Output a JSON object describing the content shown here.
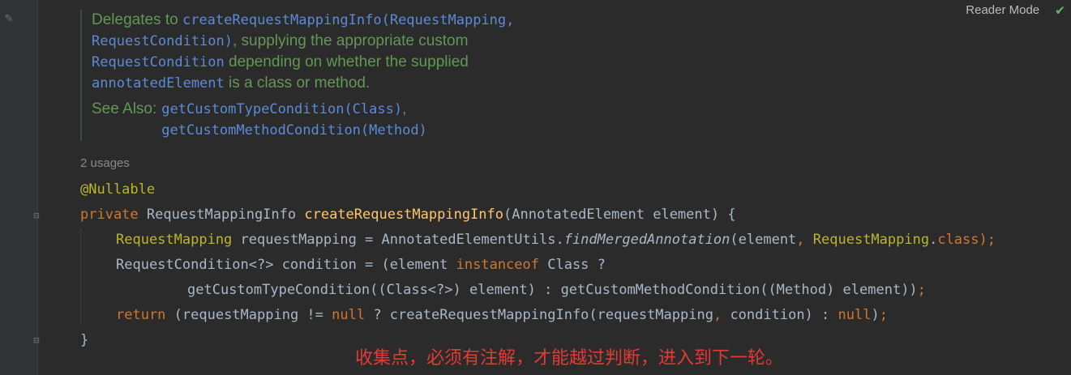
{
  "toolbar": {
    "reader_mode": "Reader Mode"
  },
  "javadoc": {
    "line1_prefix": "Delegates to ",
    "line1_code": "createRequestMappingInfo(RequestMapping,",
    "line2_code": "RequestCondition)",
    "line2_text": ", supplying the appropriate custom",
    "line3_code": "RequestCondition",
    "line3_text": " depending on whether the supplied",
    "line4_code": "annotatedElement",
    "line4_text": " is a class or method.",
    "see_also_label": "See Also:",
    "see_also_1": "getCustomTypeCondition(Class)",
    "see_also_1_sep": ",",
    "see_also_2": "getCustomMethodCondition(Method)"
  },
  "usages": "2 usages",
  "code": {
    "annotation": "@Nullable",
    "l2_kw": "private",
    "l2_type": " RequestMappingInfo ",
    "l2_fn": "createRequestMappingInfo",
    "l2_rest": "(AnnotatedElement element) {",
    "l3_ann": "RequestMapping",
    "l3_mid": " requestMapping = AnnotatedElementUtils.",
    "l3_italic": "findMergedAnnotation",
    "l3_args": "(element",
    "l3_comma": ",",
    "l3_ann2": " RequestMapping",
    "l3_dot": ".",
    "l3_class": "class",
    "l3_end": ");",
    "l4_a": "RequestCondition<?> condition = (element ",
    "l4_kw": "instanceof",
    "l4_b": " Class ?",
    "l5_a": "getCustomTypeCondition((Class<?>) element) : getCustomMethodCondition((Method) element))",
    "l5_semi": ";",
    "l6_kw": "return",
    "l6_a": " (requestMapping != ",
    "l6_null1": "null",
    "l6_b": " ? createRequestMappingInfo(requestMapping",
    "l6_comma": ",",
    "l6_c": " condition) : ",
    "l6_null2": "null",
    "l6_d": ")",
    "l6_semi": ";",
    "l7": "}"
  },
  "note": "收集点，必须有注解，才能越过判断，进入到下一轮。",
  "icons": [
    "pencil-icon",
    "checkmark-icon",
    "fold-icon"
  ]
}
